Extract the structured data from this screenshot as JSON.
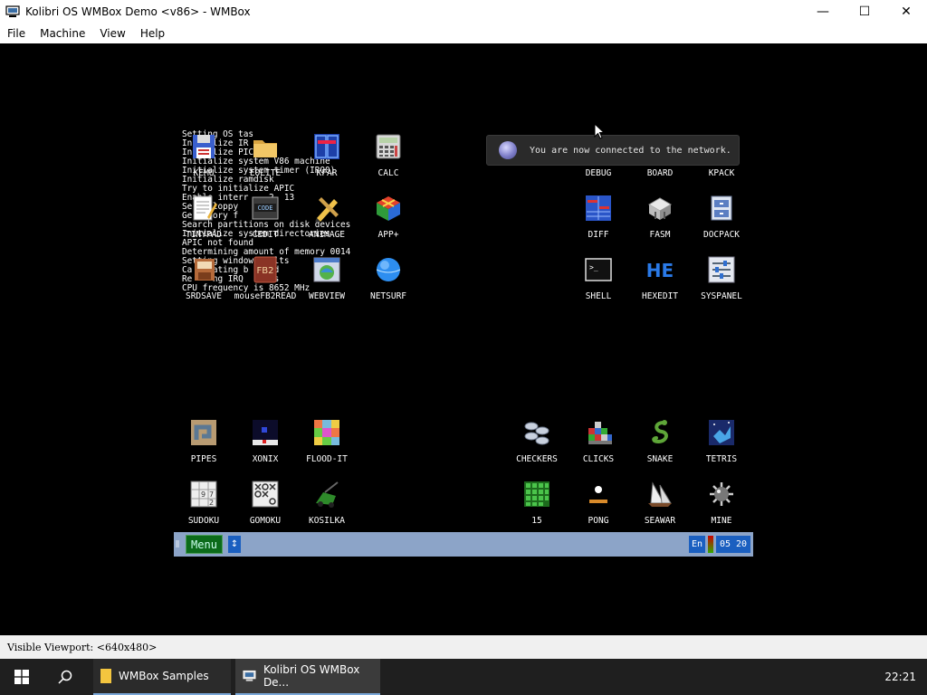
{
  "window": {
    "title": "Kolibri OS WMBox Demo <v86> - WMBox",
    "minimize": "—",
    "maximize": "☐",
    "close": "✕"
  },
  "menubar": [
    "File",
    "Machine",
    "View",
    "Help"
  ],
  "statusbar": {
    "text": "Visible Viewport: <640x480>"
  },
  "guest": {
    "boot_log": [
      "Setting OS tas",
      "Initialize IR",
      "Initialize PIC",
      "Initialize system V86 machine",
      "Initialize system timer (IRQ0)",
      "Initialize ramdisk",
      "Try to initialize APIC",
      "Enable interr    2, 13",
      "Se   floppy   es",
      "Ge   mory f    he",
      "Search partitions on disk devices",
      "Initialize system directories",
      "APIC not found",
      "Determining amount of memory 0014",
      "Setting window  aults",
      "Ca    ating b  ound",
      "Re    ng IRQ   orts",
      "CPU frequency is 8652 MHz"
    ],
    "icons": [
      {
        "label": "KEMU",
        "icon": "floppy-icon"
      },
      {
        "label": "EOLITE",
        "icon": "folder-icon"
      },
      {
        "label": "KFAR",
        "icon": "kfar-icon"
      },
      {
        "label": "CALC",
        "icon": "calculator-icon"
      },
      {
        "label": "TINYPAD",
        "icon": "notepad-icon"
      },
      {
        "label": "CEDIT",
        "icon": "code-icon"
      },
      {
        "label": "ANIMAGE",
        "icon": "pencil-icon"
      },
      {
        "label": "APP+",
        "icon": "cube-icon"
      },
      {
        "label": "SRDSAVE",
        "icon": "disk-save-icon"
      },
      {
        "label": "mouseFB2READ",
        "icon": "book-icon"
      },
      {
        "label": "WEBVIEW",
        "icon": "browser-icon"
      },
      {
        "label": "NETSURF",
        "icon": "globe-icon"
      },
      {
        "label": "DEBUG",
        "icon": "debug-icon"
      },
      {
        "label": "BOARD",
        "icon": "board-icon"
      },
      {
        "label": "KPACK",
        "icon": "archive-icon"
      },
      {
        "label": "DIFF",
        "icon": "diff-icon"
      },
      {
        "label": "FASM",
        "icon": "assembler-icon"
      },
      {
        "label": "DOCPACK",
        "icon": "docpack-icon"
      },
      {
        "label": "SHELL",
        "icon": "terminal-icon"
      },
      {
        "label": "HEXEDIT",
        "icon": "hex-icon"
      },
      {
        "label": "SYSPANEL",
        "icon": "sliders-icon"
      },
      {
        "label": "PIPES",
        "icon": "pipes-icon"
      },
      {
        "label": "XONIX",
        "icon": "xonix-icon"
      },
      {
        "label": "FLOOD-IT",
        "icon": "mosaic-icon"
      },
      {
        "label": "CHECKERS",
        "icon": "checkers-icon"
      },
      {
        "label": "CLICKS",
        "icon": "blocks-icon"
      },
      {
        "label": "SNAKE",
        "icon": "snake-icon"
      },
      {
        "label": "TETRIS",
        "icon": "tetris-icon"
      },
      {
        "label": "SUDOKU",
        "icon": "sudoku-icon"
      },
      {
        "label": "GOMOKU",
        "icon": "gomoku-icon"
      },
      {
        "label": "KOSILKA",
        "icon": "lawnmower-icon"
      },
      {
        "label": "15",
        "icon": "fifteen-icon"
      },
      {
        "label": "PONG",
        "icon": "pong-icon"
      },
      {
        "label": "SEAWAR",
        "icon": "ship-icon"
      },
      {
        "label": "MINE",
        "icon": "mine-icon"
      }
    ],
    "notification": "You are now connected to the network.",
    "taskbar": {
      "menu": "Menu",
      "updown": "↕",
      "lang": "En",
      "clock": "05 20"
    }
  },
  "host_taskbar": {
    "items": [
      {
        "label": "WMBox Samples"
      },
      {
        "label": "Kolibri OS WMBox De..."
      }
    ],
    "clock": "22:21"
  }
}
